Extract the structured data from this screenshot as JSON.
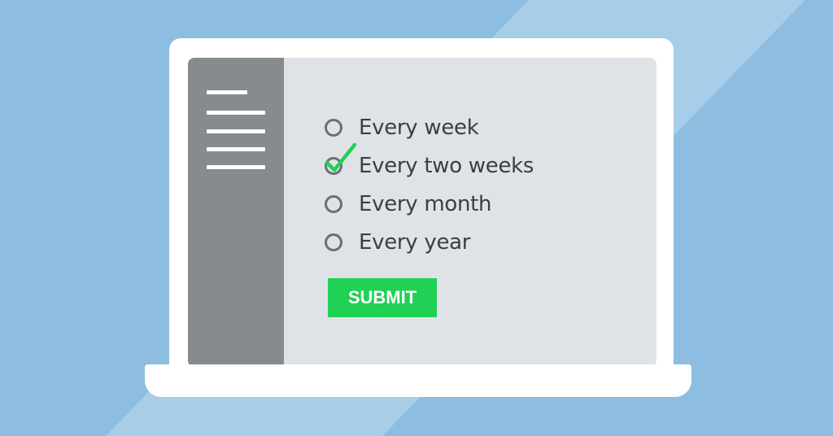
{
  "colors": {
    "background": "#8dbde0",
    "background_stripe": "#a7cde8",
    "laptop": "#ffffff",
    "screen": "#dfe3e8",
    "sidebar": "#868b8e",
    "accent": "#1fd155",
    "text": "#3b3f43"
  },
  "sidebar": {
    "icon": "menu-lines-icon"
  },
  "form": {
    "options": [
      {
        "label": "Every week",
        "selected": false
      },
      {
        "label": "Every two weeks",
        "selected": true
      },
      {
        "label": "Every month",
        "selected": false
      },
      {
        "label": "Every year",
        "selected": false
      }
    ],
    "submit_label": "SUBMIT"
  }
}
